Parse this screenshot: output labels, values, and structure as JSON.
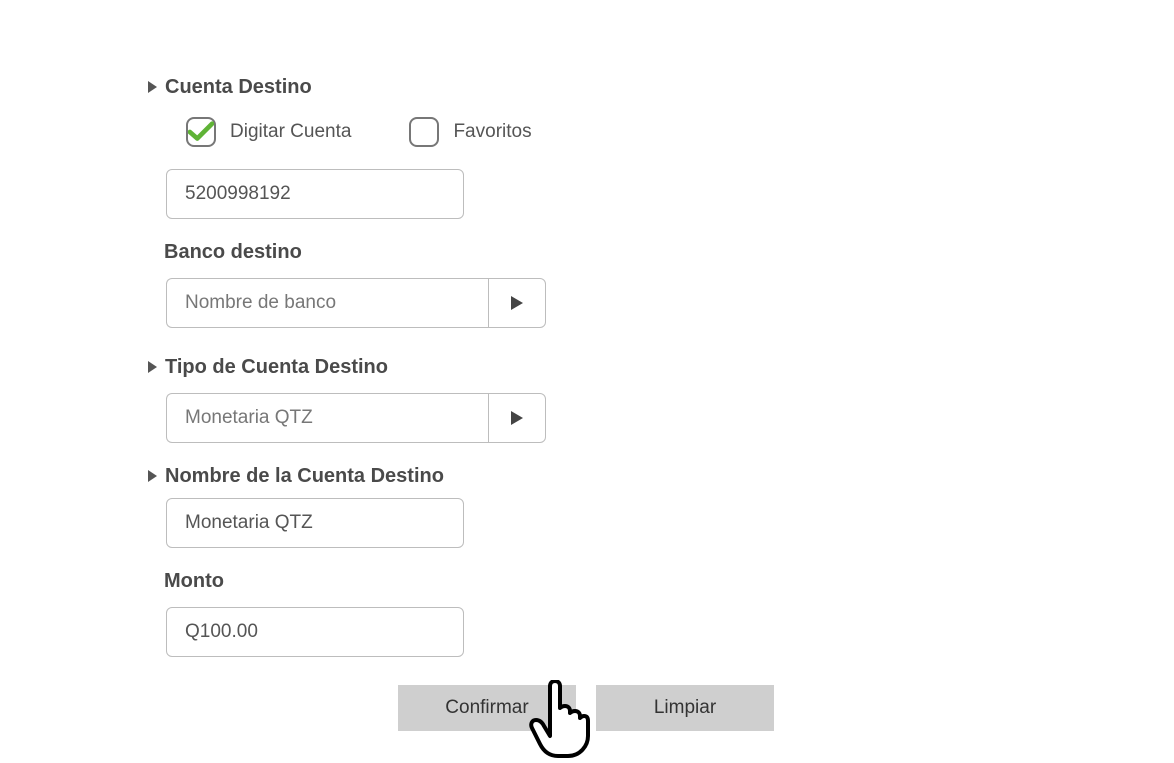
{
  "section_cuenta_destino": "Cuenta Destino",
  "checkbox_digitar": "Digitar Cuenta",
  "checkbox_favoritos": "Favoritos",
  "account_number": "5200998192",
  "label_banco_destino": "Banco destino",
  "banco_destino_value": "Nombre de banco",
  "section_tipo_cuenta": "Tipo de Cuenta Destino",
  "tipo_cuenta_value": "Monetaria QTZ",
  "section_nombre_cuenta": "Nombre de la Cuenta Destino",
  "nombre_cuenta_value": "Monetaria QTZ",
  "label_monto": "Monto",
  "monto_value": "Q100.00",
  "btn_confirmar": "Confirmar",
  "btn_limpiar": "Limpiar",
  "checkbox_digitar_checked": true,
  "checkbox_favoritos_checked": false
}
